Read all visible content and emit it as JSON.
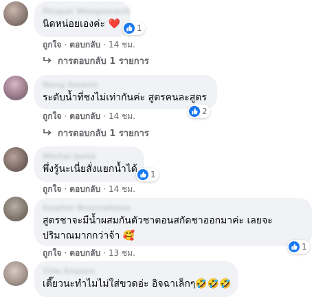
{
  "comments": [
    {
      "author": "Pirapat Wongsurasit",
      "text": "นิดหน่อยเองค่ะ ",
      "emoji": "❤️",
      "reaction_count": "1",
      "like_label": "ถูกใจ",
      "reply_label": "ตอบกลับ",
      "time": "14 ชม.",
      "replies_label": "การตอบกลับ 1 รายการ"
    },
    {
      "author": "Nong Amarin",
      "text": "ระดับน้ำที่ชงไม่เท่ากันค่ะ สูตรคนละสูตร",
      "reaction_count": "2",
      "like_label": "ถูกใจ",
      "reply_label": "ตอบกลับ",
      "time": "14 ชม.",
      "replies_label": "การตอบกลับ 1 รายการ"
    },
    {
      "author": "Wichai Janta",
      "text": "พึ่งรู้นะเนี่ยสั่งแยกน้ำได้",
      "reaction_count": "1",
      "like_label": "ถูกใจ",
      "reply_label": "ตอบกลับ",
      "time": "14 ชม."
    },
    {
      "author": "Saiphin Boonrattana",
      "text": "สูตรชาจะมีน้ำผสมกันตัวชาตอนสกัดชาออกมาค่ะ เลยจะปริมาณมากกว่าจ้า ",
      "emoji": "🥰",
      "reaction_count": "1",
      "like_label": "ถูกใจ",
      "reply_label": "ตอบกลับ",
      "time": "13 ชม."
    },
    {
      "author": "Tida Sriporn",
      "text": "เตี๊ยวนะทำไมไม่ใส่ขวดอ่ะ อิจฉาเล็กๆ",
      "emoji": "🤣🤣🤣"
    }
  ],
  "colors": {
    "like_blue": "#1877f2",
    "bubble_bg": "#f0f2f5",
    "meta_gray": "#65676b"
  },
  "icons": {
    "like": "thumbs-up-icon",
    "reply": "reply-arrow-icon"
  }
}
